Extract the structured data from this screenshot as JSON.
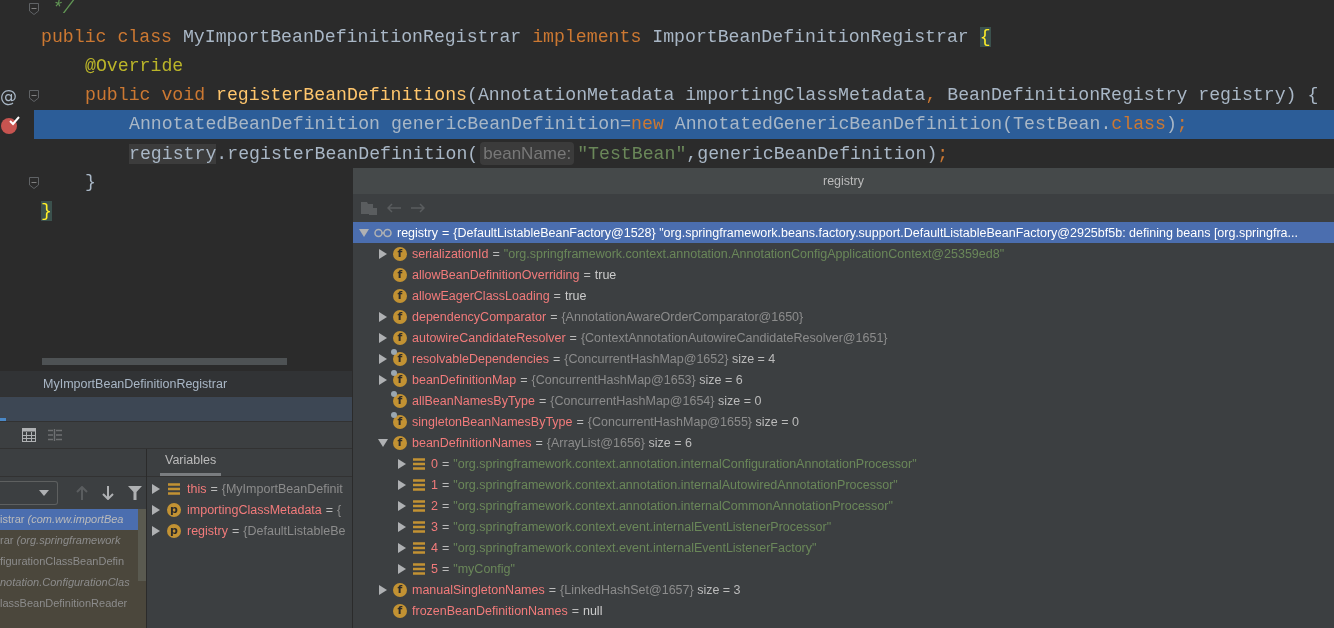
{
  "editor": {
    "lines": [
      {
        "fold": true,
        "highlighted": false,
        "tokens": [
          {
            "text": " */",
            "kind": "comment"
          }
        ]
      },
      {
        "fold": false,
        "highlighted": false,
        "tokens": [
          {
            "text": "public class ",
            "kind": "keyword"
          },
          {
            "text": "MyImportBeanDefinitionRegistrar ",
            "kind": "plain"
          },
          {
            "text": "implements ",
            "kind": "keyword"
          },
          {
            "text": "ImportBeanDefinitionRegistrar ",
            "kind": "plain"
          },
          {
            "text": "{",
            "kind": "brace"
          }
        ],
        "children": [
          {
            "fold": false,
            "highlighted": false,
            "tokens": [
              {
                "text": "@Override",
                "kind": "annotation"
              }
            ]
          },
          {
            "gutter": {
              "kind": "override",
              "mark": "@"
            },
            "fold": true,
            "highlighted": false,
            "tokens": [
              {
                "text": "public void ",
                "kind": "keyword"
              },
              {
                "text": "registerBeanDefinitions",
                "kind": "method"
              },
              {
                "text": "(AnnotationMetadata importingClassMetadata",
                "kind": "plain"
              },
              {
                "text": ",",
                "kind": "keyword"
              },
              {
                "text": " BeanDefinitionRegistry registry) {",
                "kind": "plain"
              }
            ],
            "children": [
              {
                "gutter": {
                  "kind": "breakpoint"
                },
                "fold": false,
                "highlighted": true,
                "tokens": [
                  {
                    "text": "AnnotatedBeanDefinition genericBeanDefinition=",
                    "kind": "plain"
                  },
                  {
                    "text": "new",
                    "kind": "keyword"
                  },
                  {
                    "text": " AnnotatedGenericBeanDefinition(TestBean.",
                    "kind": "plain"
                  },
                  {
                    "text": "class",
                    "kind": "keyword"
                  },
                  {
                    "text": ")",
                    "kind": "plain"
                  },
                  {
                    "text": ";",
                    "kind": "keyword"
                  }
                ]
              },
              {
                "fold": false,
                "highlighted": false,
                "tokens": [
                  {
                    "text": "registry",
                    "kind": "ref"
                  },
                  {
                    "text": ".registerBeanDefinition(",
                    "kind": "plain"
                  },
                  {
                    "text": "beanName:",
                    "kind": "hint"
                  },
                  {
                    "text": "\"TestBean\"",
                    "kind": "string"
                  },
                  {
                    "text": ",genericBeanDefinition)",
                    "kind": "plain"
                  },
                  {
                    "text": ";",
                    "kind": "keyword"
                  }
                ]
              }
            ]
          },
          {
            "fold": true,
            "highlighted": false,
            "tokens": [
              {
                "text": "}",
                "kind": "plain"
              }
            ]
          }
        ]
      },
      {
        "fold": false,
        "highlighted": false,
        "tokens": [
          {
            "text": "}",
            "kind": "brace"
          }
        ]
      }
    ]
  },
  "breadcrumb": "MyImportBeanDefinitionRegistrar",
  "frames": [
    {
      "method": "istrar",
      "location": "(com.ww.importBea",
      "selected": true
    },
    {
      "method": "rar",
      "location": "(org.springframework",
      "selected": false
    },
    {
      "method": "figurationClassBeanDefin",
      "selected": false
    },
    {
      "location": "notation.ConfigurationClas",
      "selected": false
    },
    {
      "method": "lassBeanDefinitionReader",
      "selected": false
    }
  ],
  "variables_tab": {
    "label": "Variables",
    "selected": true
  },
  "variables": [
    {
      "name": "this",
      "op": "=",
      "value": "{MyImportBeanDefinit",
      "icon": {
        "kind": "element"
      }
    },
    {
      "name": "importingClassMetadata",
      "op": "=",
      "value": "{",
      "icon": {
        "kind": "param",
        "letter": "p"
      }
    },
    {
      "name": "registry",
      "op": "=",
      "value": "{DefaultListableBe",
      "icon": {
        "kind": "param",
        "letter": "p"
      }
    }
  ],
  "popup": {
    "title": "registry",
    "tree": [
      {
        "name": "registry",
        "op": "=",
        "value": "{DefaultListableBeanFactory@1528}",
        "kind": "object",
        "description": "\"org.springframework.beans.factory.support.DefaultListableBeanFactory@2925bf5b: defining beans [org.springfra...",
        "icon": {
          "kind": "watch"
        },
        "expanded": true,
        "selected": true,
        "children": [
          {
            "name": "serializationId",
            "op": "=",
            "value": "\"org.springframework.context.annotation.AnnotationConfigApplicationContext@25359ed8\"",
            "kind": "string",
            "icon": {
              "kind": "field",
              "letter": "f"
            },
            "expanded": false,
            "selected": false
          },
          {
            "name": "allowBeanDefinitionOverriding",
            "op": "=",
            "value": "true",
            "kind": "literal",
            "icon": {
              "kind": "field",
              "letter": "f"
            },
            "selected": false
          },
          {
            "name": "allowEagerClassLoading",
            "op": "=",
            "value": "true",
            "kind": "literal",
            "icon": {
              "kind": "field",
              "letter": "f"
            },
            "selected": false
          },
          {
            "name": "dependencyComparator",
            "op": "=",
            "value": "{AnnotationAwareOrderComparator@1650}",
            "kind": "object",
            "icon": {
              "kind": "field",
              "letter": "f"
            },
            "expanded": false,
            "selected": false
          },
          {
            "name": "autowireCandidateResolver",
            "op": "=",
            "value": "{ContextAnnotationAutowireCandidateResolver@1651}",
            "kind": "object",
            "icon": {
              "kind": "field",
              "letter": "f"
            },
            "expanded": false,
            "selected": false
          },
          {
            "name": "resolvableDependencies",
            "op": "=",
            "value": "{ConcurrentHashMap@1652}",
            "kind": "object",
            "note": "size = 4",
            "icon": {
              "kind": "static-field",
              "letter": "f"
            },
            "expanded": false,
            "selected": false
          },
          {
            "name": "beanDefinitionMap",
            "op": "=",
            "value": "{ConcurrentHashMap@1653}",
            "kind": "object",
            "note": "size = 6",
            "icon": {
              "kind": "static-field",
              "letter": "f"
            },
            "expanded": false,
            "selected": false
          },
          {
            "name": "allBeanNamesByType",
            "op": "=",
            "value": "{ConcurrentHashMap@1654}",
            "kind": "object",
            "note": "size = 0",
            "icon": {
              "kind": "static-field",
              "letter": "f"
            },
            "selected": false
          },
          {
            "name": "singletonBeanNamesByType",
            "op": "=",
            "value": "{ConcurrentHashMap@1655}",
            "kind": "object",
            "note": "size = 0",
            "icon": {
              "kind": "static-field",
              "letter": "f"
            },
            "selected": false
          },
          {
            "name": "beanDefinitionNames",
            "op": "=",
            "value": "{ArrayList@1656}",
            "kind": "object",
            "note": "size = 6",
            "icon": {
              "kind": "field",
              "letter": "f"
            },
            "expanded": true,
            "selected": false,
            "children": [
              {
                "name": "0",
                "op": "=",
                "value": "\"org.springframework.context.annotation.internalConfigurationAnnotationProcessor\"",
                "kind": "string",
                "icon": {
                  "kind": "element"
                },
                "expanded": false,
                "selected": false
              },
              {
                "name": "1",
                "op": "=",
                "value": "\"org.springframework.context.annotation.internalAutowiredAnnotationProcessor\"",
                "kind": "string",
                "icon": {
                  "kind": "element"
                },
                "expanded": false,
                "selected": false
              },
              {
                "name": "2",
                "op": "=",
                "value": "\"org.springframework.context.annotation.internalCommonAnnotationProcessor\"",
                "kind": "string",
                "icon": {
                  "kind": "element"
                },
                "expanded": false,
                "selected": false
              },
              {
                "name": "3",
                "op": "=",
                "value": "\"org.springframework.context.event.internalEventListenerProcessor\"",
                "kind": "string",
                "icon": {
                  "kind": "element"
                },
                "expanded": false,
                "selected": false
              },
              {
                "name": "4",
                "op": "=",
                "value": "\"org.springframework.context.event.internalEventListenerFactory\"",
                "kind": "string",
                "icon": {
                  "kind": "element"
                },
                "expanded": false,
                "selected": false
              },
              {
                "name": "5",
                "op": "=",
                "value": "\"myConfig\"",
                "kind": "string",
                "icon": {
                  "kind": "element"
                },
                "expanded": false,
                "selected": false
              }
            ]
          },
          {
            "name": "manualSingletonNames",
            "op": "=",
            "value": "{LinkedHashSet@1657}",
            "kind": "object",
            "note": "size = 3",
            "icon": {
              "kind": "field",
              "letter": "f"
            },
            "expanded": false,
            "selected": false
          },
          {
            "name": "frozenBeanDefinitionNames",
            "op": "=",
            "value": "null",
            "kind": "literal",
            "icon": {
              "kind": "field",
              "letter": "f"
            },
            "selected": false
          }
        ]
      }
    ]
  }
}
